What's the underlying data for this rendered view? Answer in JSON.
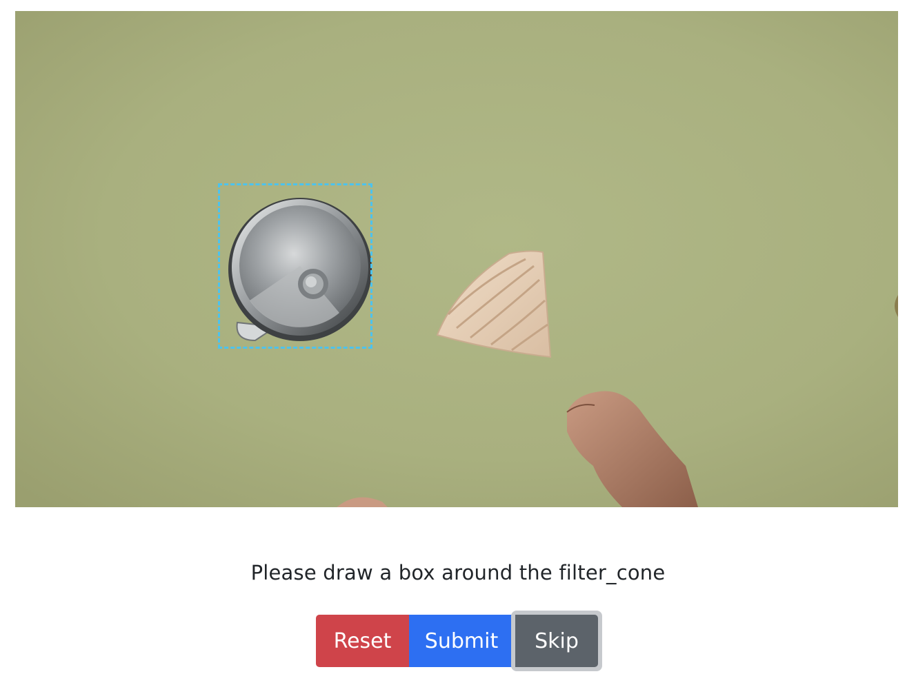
{
  "prompt": {
    "text": "Please draw a box around the filter_cone"
  },
  "buttons": {
    "reset_label": "Reset",
    "submit_label": "Submit",
    "skip_label": "Skip"
  },
  "colors": {
    "background": "#a9b07f",
    "bbox_outline": "#4cc3ee",
    "reset": "#cf444a",
    "submit": "#2d6ff2",
    "skip": "#5c636a",
    "skip_focus_ring": "#c6c9cd"
  }
}
